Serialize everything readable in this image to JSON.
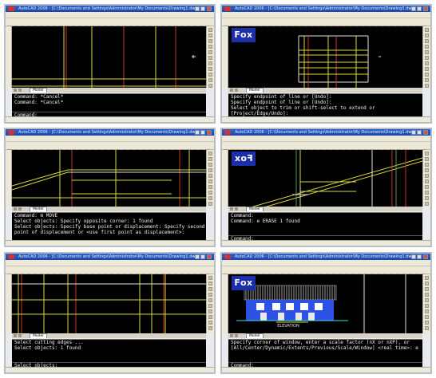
{
  "app": {
    "title_text": "AutoCAD 2006 - [C:\\Documents and Settings\\Administrator\\My Documents\\Drawing1.dwg]",
    "menu_items": [
      "File",
      "Edit",
      "View",
      "Insert",
      "Format",
      "Tools",
      "Draw",
      "Dimension",
      "Modify",
      "Window",
      "Help"
    ],
    "model_tab": "Model",
    "status_text": "Snap  Grid  Ortho  Polar  Osnap  Otrack  Lwt  Model"
  },
  "watermark": "Fox",
  "panels": [
    {
      "id": "p1",
      "show_logo": false,
      "command_lines": [
        "Command: *Cancel*",
        "Command: *Cancel*"
      ],
      "prompt": "Command:"
    },
    {
      "id": "p2",
      "show_logo": true,
      "logo_mirrored": false,
      "command_lines": [
        "Specify endpoint of line or [Undo]:",
        "Specify endpoint of line or [Undo]:",
        "Select object to trim or shift-select to extend or",
        "[Project/Edge/Undo]:"
      ],
      "prompt": ""
    },
    {
      "id": "p3",
      "show_logo": false,
      "command_lines": [
        "Command: m MOVE",
        "Select objects: Specify opposite corner: 1 found",
        "Select objects: Specify base point or displacement: Specify second",
        "point of displacement or <use first point as displacement>:"
      ],
      "prompt": ""
    },
    {
      "id": "p4",
      "show_logo": true,
      "logo_mirrored": true,
      "command_lines": [
        "Command:",
        "Command: e ERASE 1 found"
      ],
      "prompt": "Command:"
    },
    {
      "id": "p5",
      "show_logo": false,
      "command_lines": [
        "Select cutting edges ...",
        "Select objects: 1 found"
      ],
      "prompt": "Select objects:"
    },
    {
      "id": "p6",
      "show_logo": true,
      "logo_mirrored": false,
      "command_lines": [
        "Specify corner of window, enter a scale factor (nX or nXP), or",
        "[All/Center/Dynamic/Extents/Previous/Scale/Window] <real time>: e"
      ],
      "prompt": "Command:",
      "drawing_label": "ELEVATION"
    }
  ],
  "colors": {
    "cad_background": "#000000",
    "line_yellow": "#d8d840",
    "line_red": "#c83232",
    "line_green": "#50a050",
    "line_white": "#e0e0e0",
    "title_blue": "#1a47a8",
    "building_blue": "#2d50e6"
  },
  "icons": [
    "app-icon",
    "minimize-icon",
    "maximize-icon",
    "close-icon",
    "tool-icon",
    "crosshair-icon"
  ]
}
